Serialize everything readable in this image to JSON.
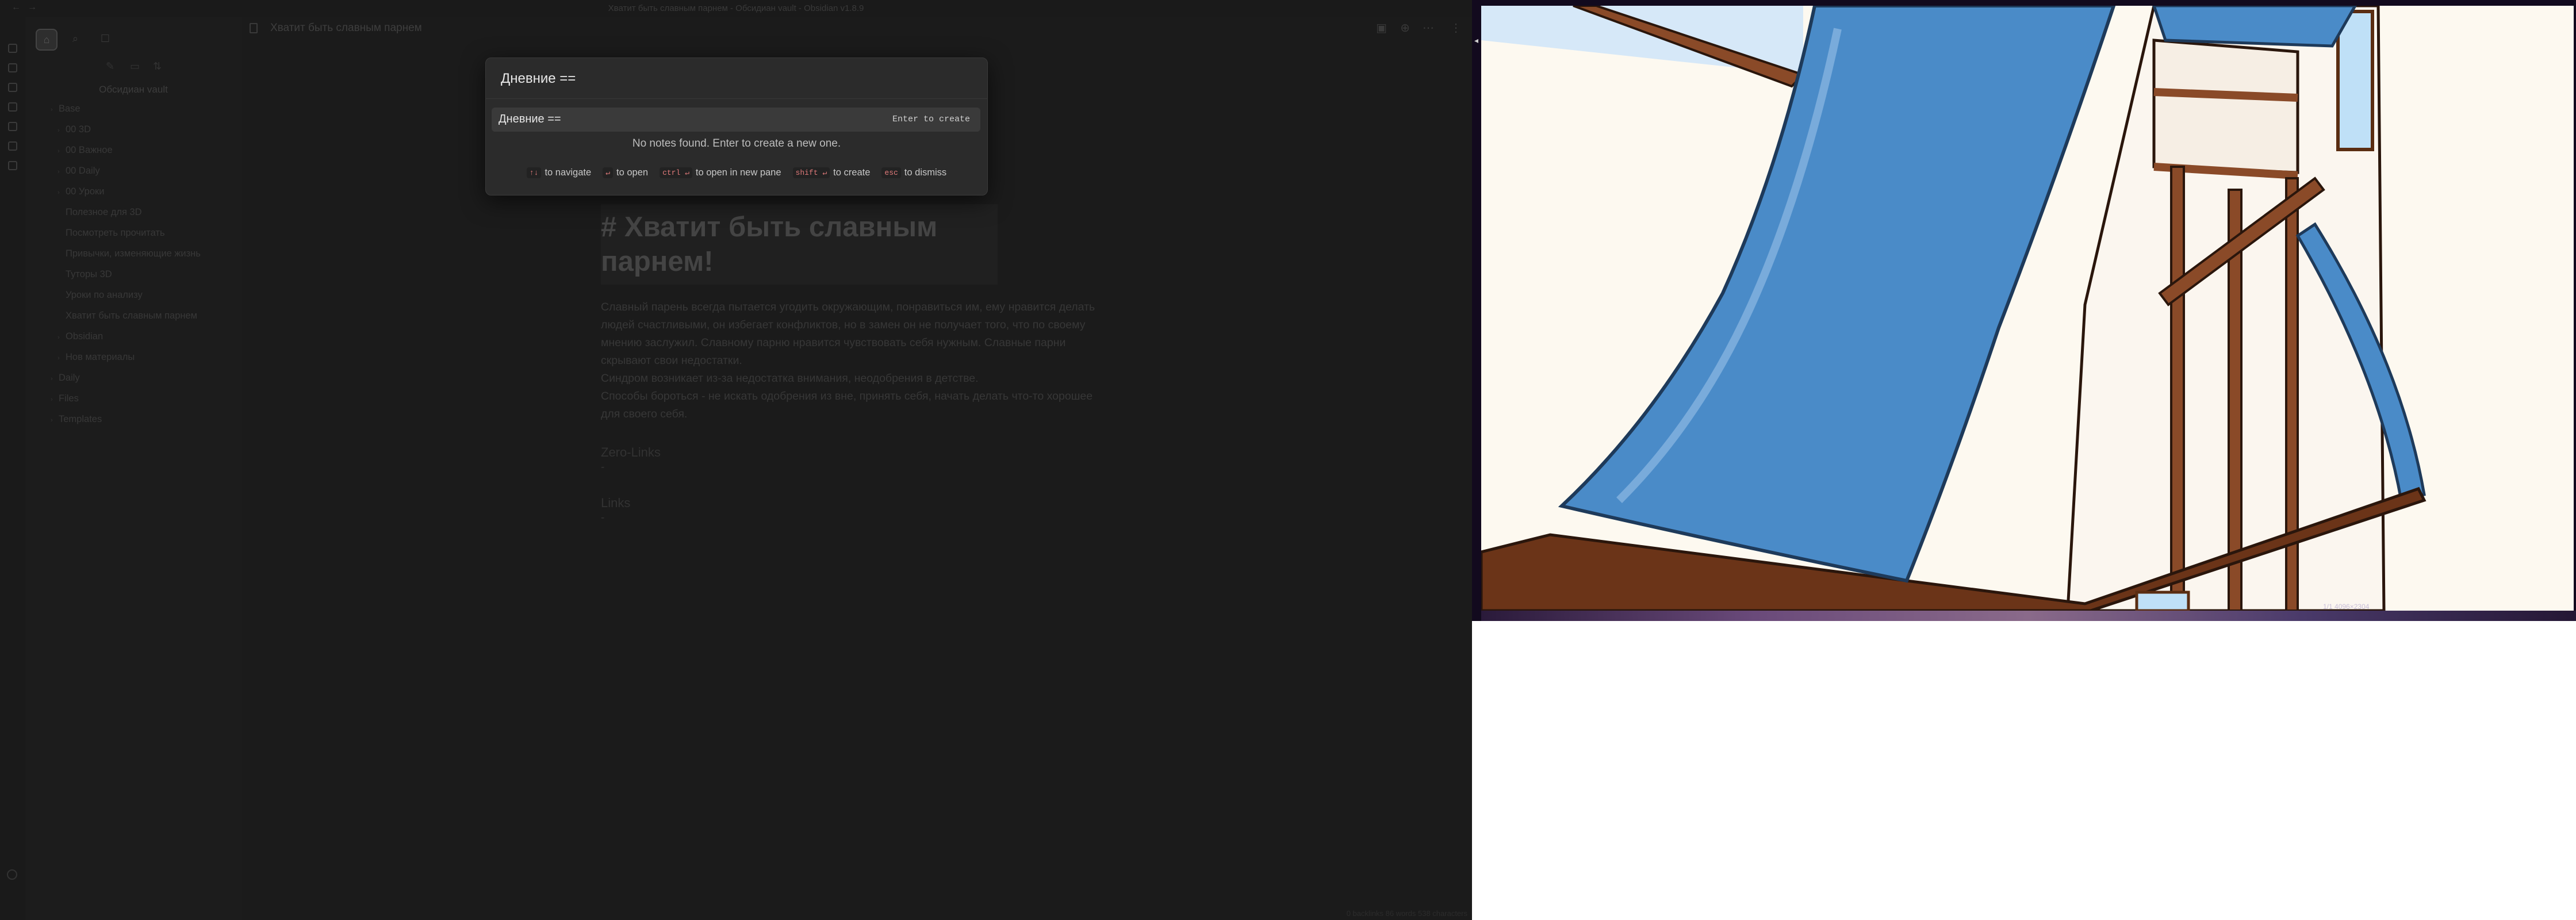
{
  "window": {
    "title": "Хватит быть славным парнем - Обсидиан vault - Obsidian v1.8.9"
  },
  "sidebar": {
    "vault_name": "Обсидиан vault",
    "tree": [
      {
        "label": "Base",
        "level": 0,
        "folder": true
      },
      {
        "label": "00 3D",
        "level": 1,
        "folder": true
      },
      {
        "label": "00 Важное",
        "level": 1,
        "folder": true
      },
      {
        "label": "00 Daily",
        "level": 1,
        "folder": true
      },
      {
        "label": "00 Уроки",
        "level": 1,
        "folder": true
      },
      {
        "label": "Полезное для 3D",
        "level": 1,
        "folder": false
      },
      {
        "label": "Посмотреть прочитать",
        "level": 1,
        "folder": false
      },
      {
        "label": "Привычки, изменяющие жизнь",
        "level": 1,
        "folder": false
      },
      {
        "label": "Туторы 3D",
        "level": 1,
        "folder": false
      },
      {
        "label": "Уроки по анализу",
        "level": 1,
        "folder": false
      },
      {
        "label": "Хватит быть славным парнем",
        "level": 1,
        "folder": false
      },
      {
        "label": "Obsidian",
        "level": 1,
        "folder": true
      },
      {
        "label": "Нов материалы",
        "level": 1,
        "folder": true
      },
      {
        "label": "Daily",
        "level": 0,
        "folder": true
      },
      {
        "label": "Files",
        "level": 0,
        "folder": true
      },
      {
        "label": "Templates",
        "level": 0,
        "folder": true
      }
    ]
  },
  "tab": {
    "title": "Хватит быть славным парнем"
  },
  "note": {
    "heading": "# Хватит быть славным парнем!",
    "paragraphs": [
      "Славный парень всегда пытается угодить окружающим, понравиться им, ему нравится делать людей счастливыми, он избегает конфликтов, но в замен он не получает того, что по своему мнению заслужил. Славному парню нравится чувствовать себя нужным. Славные парни скрывают свои недостатки.",
      "Синдром возникает из-за недостатка внимания, неодобрения в детстве.",
      "Способы бороться - не искать одобрения из вне, принять себя, начать делать что-то хорошее для своего себя."
    ],
    "sections": [
      {
        "title": "Zero-Links",
        "item": "-"
      },
      {
        "title": "Links",
        "item": "-"
      }
    ]
  },
  "quick_switcher": {
    "input_value": "Дневние ==",
    "suggestion_text": "Дневние ==",
    "suggestion_hint": "Enter to create",
    "empty_message": "No notes found. Enter to create a new one.",
    "instructions": [
      {
        "key": "↑↓",
        "label": "to navigate"
      },
      {
        "key": "↵",
        "label": "to open"
      },
      {
        "key": "ctrl ↵",
        "label": "to open in new pane"
      },
      {
        "key": "shift ↵",
        "label": "to create"
      },
      {
        "key": "esc",
        "label": "to dismiss"
      }
    ]
  },
  "statusbar": {
    "text": "0 backlinks   86 words   538 characters"
  },
  "viewer": {
    "overlay_text": "1/1 4096×2304",
    "colors": {
      "sky": "#cfe4f7",
      "banner": "#4a8bc8",
      "wall": "#faf5ee",
      "timber": "#8a4a28"
    }
  }
}
